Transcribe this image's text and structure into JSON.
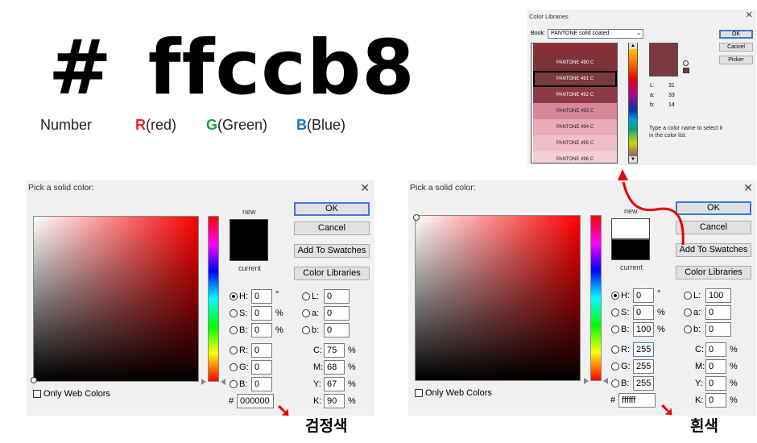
{
  "title": {
    "hash": "#",
    "hex": "ffccb8"
  },
  "legend": {
    "number": "Number",
    "r_letter": "R",
    "r_rest": "(red)",
    "g_letter": "G",
    "g_rest": "(Green)",
    "b_letter": "B",
    "b_rest": "(Blue)"
  },
  "left_dialog": {
    "title": "Pick a solid color:",
    "new_label": "new",
    "current_label": "current",
    "new_color": "#000000",
    "current_color": "#000000",
    "buttons": {
      "ok": "OK",
      "cancel": "Cancel",
      "add": "Add To Swatches",
      "libraries": "Color Libraries"
    },
    "h": "0",
    "s": "0",
    "b": "0",
    "r": "0",
    "g": "0",
    "bb": "0",
    "l": "0",
    "a": "0",
    "lab_b": "0",
    "c": "75",
    "m": "68",
    "y": "67",
    "k": "90",
    "hex": "000000",
    "web_only": "Only Web Colors",
    "labels": {
      "h": "H:",
      "s": "S:",
      "b": "B:",
      "r": "R:",
      "g": "G:",
      "bb": "B:",
      "l": "L:",
      "a": "a:",
      "lab_b": "b:",
      "c": "C:",
      "m": "M:",
      "y": "Y:",
      "k": "K:",
      "hash": "#",
      "deg": "°",
      "pct": "%"
    },
    "annotation": "검정색"
  },
  "right_dialog": {
    "title": "Pick a solid color:",
    "new_label": "new",
    "current_label": "current",
    "new_color": "#ffffff",
    "current_color": "#000000",
    "buttons": {
      "ok": "OK",
      "cancel": "Cancel",
      "add": "Add To Swatches",
      "libraries": "Color Libraries"
    },
    "h": "0",
    "s": "0",
    "b": "100",
    "r": "255",
    "g": "255",
    "bb": "255",
    "l": "100",
    "a": "0",
    "lab_b": "0",
    "c": "0",
    "m": "0",
    "y": "0",
    "k": "0",
    "hex": "ffffff",
    "web_only": "Only Web Colors",
    "labels": {
      "h": "H:",
      "s": "S:",
      "b": "B:",
      "r": "R:",
      "g": "G:",
      "bb": "B:",
      "l": "L:",
      "a": "a:",
      "lab_b": "b:",
      "c": "C:",
      "m": "M:",
      "y": "Y:",
      "k": "K:",
      "hash": "#",
      "deg": "°",
      "pct": "%"
    },
    "annotation": "흰색"
  },
  "libraries_dialog": {
    "title": "Color Libraries",
    "book_label": "Book:",
    "book_value": "PANTONE solid coated",
    "buttons": {
      "ok": "OK",
      "cancel": "Cancel",
      "picker": "Picker"
    },
    "swatches": [
      {
        "name": "",
        "color": "#8a2f35"
      },
      {
        "name": "PANTONE 490 C",
        "color": "#7b3338"
      },
      {
        "name": "PANTONE 491 C",
        "color": "#7a3a3e"
      },
      {
        "name": "PANTONE 492 C",
        "color": "#8e3a44"
      },
      {
        "name": "PANTONE 493 C",
        "color": "#d7879a"
      },
      {
        "name": "PANTONE 494 C",
        "color": "#e8aab8"
      },
      {
        "name": "PANTONE 495 C",
        "color": "#efbfc9"
      },
      {
        "name": "PANTONE 496 C",
        "color": "#f3cfd6"
      }
    ],
    "preview_color": "#7a3a3e",
    "lab": {
      "l_label": "L:",
      "l": "31",
      "a_label": "a:",
      "a": "33",
      "b_label": "b:",
      "b": "14"
    },
    "hint": "Type a color name to select it in the color list."
  }
}
